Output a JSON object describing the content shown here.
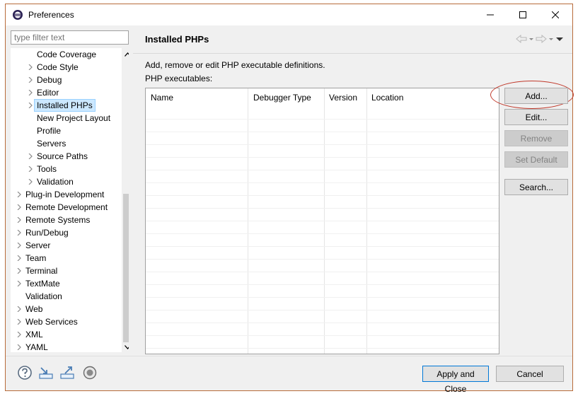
{
  "window": {
    "title": "Preferences",
    "app_icon": "eclipse-icon",
    "controls": [
      "minimize-icon",
      "maximize-icon",
      "close-icon"
    ]
  },
  "filter": {
    "placeholder": "type filter text",
    "value": ""
  },
  "tree": {
    "items": [
      {
        "label": "Code Coverage",
        "expandable": false
      },
      {
        "label": "Code Style",
        "expandable": true
      },
      {
        "label": "Debug",
        "expandable": true
      },
      {
        "label": "Editor",
        "expandable": true
      },
      {
        "label": "Installed PHPs",
        "expandable": true,
        "selected": true
      },
      {
        "label": "New Project Layout",
        "expandable": false
      },
      {
        "label": "Profile",
        "expandable": false
      },
      {
        "label": "Servers",
        "expandable": false
      },
      {
        "label": "Source Paths",
        "expandable": true
      },
      {
        "label": "Tools",
        "expandable": true
      },
      {
        "label": "Validation",
        "expandable": true
      },
      {
        "label": "Plug-in Development",
        "expandable": true
      },
      {
        "label": "Remote Development",
        "expandable": true
      },
      {
        "label": "Remote Systems",
        "expandable": true
      },
      {
        "label": "Run/Debug",
        "expandable": true
      },
      {
        "label": "Server",
        "expandable": true
      },
      {
        "label": "Team",
        "expandable": true
      },
      {
        "label": "Terminal",
        "expandable": true
      },
      {
        "label": "TextMate",
        "expandable": true
      },
      {
        "label": "Validation",
        "expandable": false
      },
      {
        "label": "Web",
        "expandable": true
      },
      {
        "label": "Web Services",
        "expandable": true
      },
      {
        "label": "XML",
        "expandable": true
      },
      {
        "label": "YAML",
        "expandable": true
      }
    ]
  },
  "page": {
    "title": "Installed PHPs",
    "description": "Add, remove or edit PHP executable definitions.",
    "executables_label": "PHP executables:",
    "nav_icons": [
      "back-arrow-icon",
      "dropdown-icon",
      "forward-arrow-icon",
      "dropdown-icon",
      "menu-icon"
    ]
  },
  "table": {
    "columns": [
      "Name",
      "Debugger Type",
      "Version",
      "Location"
    ],
    "rows": []
  },
  "buttons": {
    "add": "Add...",
    "edit": "Edit...",
    "remove": "Remove",
    "set_default": "Set Default",
    "search": "Search..."
  },
  "footer": {
    "icons": [
      "help-icon",
      "import-icon",
      "export-icon",
      "oomph-icon"
    ],
    "apply_and_close": "Apply and Close",
    "cancel": "Cancel"
  },
  "colors": {
    "selection": "#cce8ff",
    "annotation": "#c0392b",
    "default_button_border": "#0078d7"
  }
}
